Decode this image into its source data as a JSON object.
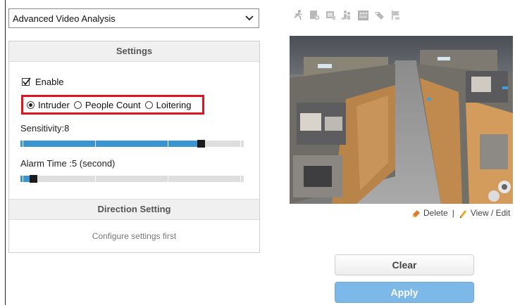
{
  "dropdown": {
    "selected": "Advanced Video Analysis"
  },
  "settings": {
    "header": "Settings",
    "enable_label": "Enable",
    "enable_checked": true,
    "modes": [
      {
        "label": "Intruder",
        "selected": true
      },
      {
        "label": "People Count",
        "selected": false
      },
      {
        "label": "Loitering",
        "selected": false
      }
    ],
    "sensitivity_label": "Sensitivity:8",
    "sensitivity_fraction": 0.8,
    "alarm_label": "Alarm Time :5 (second)",
    "alarm_fraction": 0.05
  },
  "direction": {
    "header": "Direction Setting",
    "message": "Configure settings first"
  },
  "toolbar": {
    "icons": [
      "person-run-icon",
      "camera-settings-icon",
      "display-icon",
      "people-icon",
      "crowd-icon",
      "tag-icon",
      "flag-icon"
    ]
  },
  "video_links": {
    "delete_label": "Delete",
    "view_edit_label": "View / Edit"
  },
  "buttons": {
    "clear_label": "Clear",
    "apply_label": "Apply"
  },
  "colors": {
    "accent_blue": "#3b94cf",
    "highlight_red": "#e0141e",
    "apply_blue": "#7cb8e8"
  }
}
